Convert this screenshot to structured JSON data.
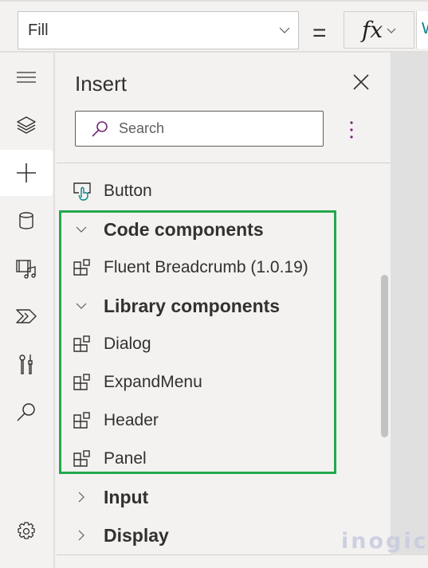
{
  "formula_bar": {
    "property": "Fill",
    "equals": "=",
    "fx_label": "fx",
    "formula_value": "W"
  },
  "rail": {
    "items": [
      {
        "name": "menu",
        "icon": "hamburger-icon"
      },
      {
        "name": "tree-view",
        "icon": "layers-icon"
      },
      {
        "name": "insert",
        "icon": "plus-icon",
        "selected": true
      },
      {
        "name": "data",
        "icon": "database-icon"
      },
      {
        "name": "media",
        "icon": "media-icon"
      },
      {
        "name": "power-automate",
        "icon": "power-automate-icon"
      },
      {
        "name": "advanced-tools",
        "icon": "tools-icon"
      },
      {
        "name": "search",
        "icon": "search-icon"
      },
      {
        "name": "settings",
        "icon": "gear-icon"
      }
    ]
  },
  "panel": {
    "title": "Insert",
    "search_placeholder": "Search",
    "items": [
      {
        "type": "item",
        "label": "Button",
        "icon": "button-icon"
      },
      {
        "type": "group",
        "label": "Code components",
        "expanded": true
      },
      {
        "type": "item",
        "label": "Fluent Breadcrumb (1.0.19)",
        "icon": "component-icon"
      },
      {
        "type": "group",
        "label": "Library components",
        "expanded": true
      },
      {
        "type": "item",
        "label": "Dialog",
        "icon": "component-icon"
      },
      {
        "type": "item",
        "label": "ExpandMenu",
        "icon": "component-icon"
      },
      {
        "type": "item",
        "label": "Header",
        "icon": "component-icon"
      },
      {
        "type": "item",
        "label": "Panel",
        "icon": "component-icon"
      },
      {
        "type": "group",
        "label": "Input",
        "expanded": false
      },
      {
        "type": "group",
        "label": "Display",
        "expanded": false
      }
    ]
  },
  "colors": {
    "highlight": "#21a94c",
    "accent": "#742774",
    "button_icon_accent": "#038387"
  },
  "watermark": "inogic"
}
